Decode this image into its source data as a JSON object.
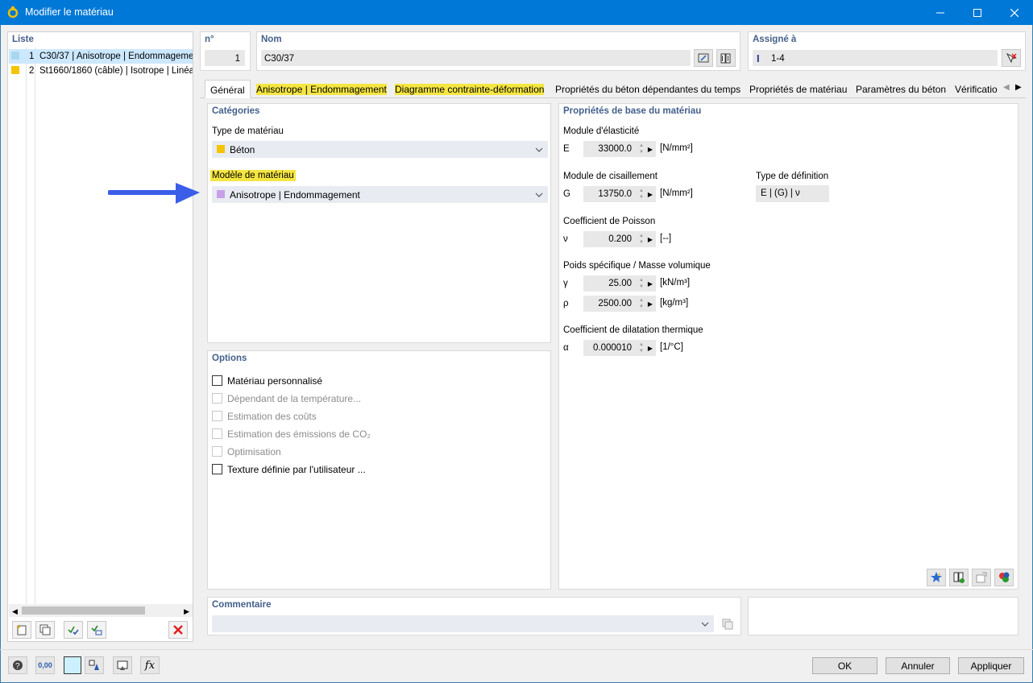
{
  "window": {
    "title": "Modifier le matériau",
    "minimize": "—",
    "maximize": "☐",
    "close": "✕"
  },
  "list": {
    "header": "Liste",
    "items": [
      {
        "num": "1",
        "label": "C30/37 | Anisotrope | Endommageme",
        "color": "#a8d8f0"
      },
      {
        "num": "2",
        "label": "St1660/1860 (câble) | Isotrope | Linéai",
        "color": "#f5c400"
      }
    ]
  },
  "header": {
    "num_label": "n°",
    "num_value": "1",
    "name_label": "Nom",
    "name_value": "C30/37",
    "assigned_label": "Assigné à",
    "assigned_value": "1-4"
  },
  "tabs": [
    {
      "label": "Général",
      "active": true,
      "highlight": false
    },
    {
      "label": "Anisotrope | Endommagement",
      "active": false,
      "highlight": true
    },
    {
      "label": "Diagramme contrainte-déformation",
      "active": false,
      "highlight": true
    },
    {
      "label": "Propriétés du béton dépendantes du temps",
      "active": false,
      "highlight": false
    },
    {
      "label": "Propriétés de matériau",
      "active": false,
      "highlight": false
    },
    {
      "label": "Paramètres du béton",
      "active": false,
      "highlight": false
    },
    {
      "label": "Vérificatio",
      "active": false,
      "highlight": false
    }
  ],
  "categories": {
    "header": "Catégories",
    "material_type_label": "Type de matériau",
    "material_type_value": "Béton",
    "material_type_color": "#f5c400",
    "material_model_label": "Modèle de matériau",
    "material_model_value": "Anisotrope | Endommagement",
    "material_model_color": "#c8a0e8"
  },
  "options": {
    "header": "Options",
    "items": [
      {
        "label": "Matériau personnalisé",
        "enabled": true
      },
      {
        "label": "Dépendant de la température...",
        "enabled": false
      },
      {
        "label": "Estimation des coûts",
        "enabled": false
      },
      {
        "label": "Estimation des émissions de CO₂",
        "enabled": false
      },
      {
        "label": "Optimisation",
        "enabled": false
      },
      {
        "label": "Texture définie par l'utilisateur ...",
        "enabled": true
      }
    ]
  },
  "properties": {
    "header": "Propriétés de base du matériau",
    "elasticity": {
      "title": "Module d'élasticité",
      "symbol": "E",
      "value": "33000.0",
      "unit": "[N/mm²]"
    },
    "shear": {
      "title": "Module de cisaillement",
      "symbol": "G",
      "value": "13750.0",
      "unit": "[N/mm²]"
    },
    "definition": {
      "title": "Type de définition",
      "value": "E | (G) | ν"
    },
    "poisson": {
      "title": "Coefficient de Poisson",
      "symbol": "ν",
      "value": "0.200",
      "unit": "[--]"
    },
    "weight": {
      "title": "Poids spécifique / Masse volumique",
      "gamma_symbol": "γ",
      "gamma_value": "25.00",
      "gamma_unit": "[kN/m³]",
      "rho_symbol": "ρ",
      "rho_value": "2500.00",
      "rho_unit": "[kg/m³]"
    },
    "thermal": {
      "title": "Coefficient de dilatation thermique",
      "symbol": "α",
      "value": "0.000010",
      "unit": "[1/°C]"
    }
  },
  "comment": {
    "header": "Commentaire",
    "value": ""
  },
  "buttons": {
    "ok": "OK",
    "cancel": "Annuler",
    "apply": "Appliquer"
  },
  "bottom_toolbar": {
    "units_label": "0,00"
  },
  "colors": {
    "accent": "#0078d7",
    "highlight": "#f5e642",
    "arrow": "#3a5ee8",
    "group_header": "#44608a"
  }
}
